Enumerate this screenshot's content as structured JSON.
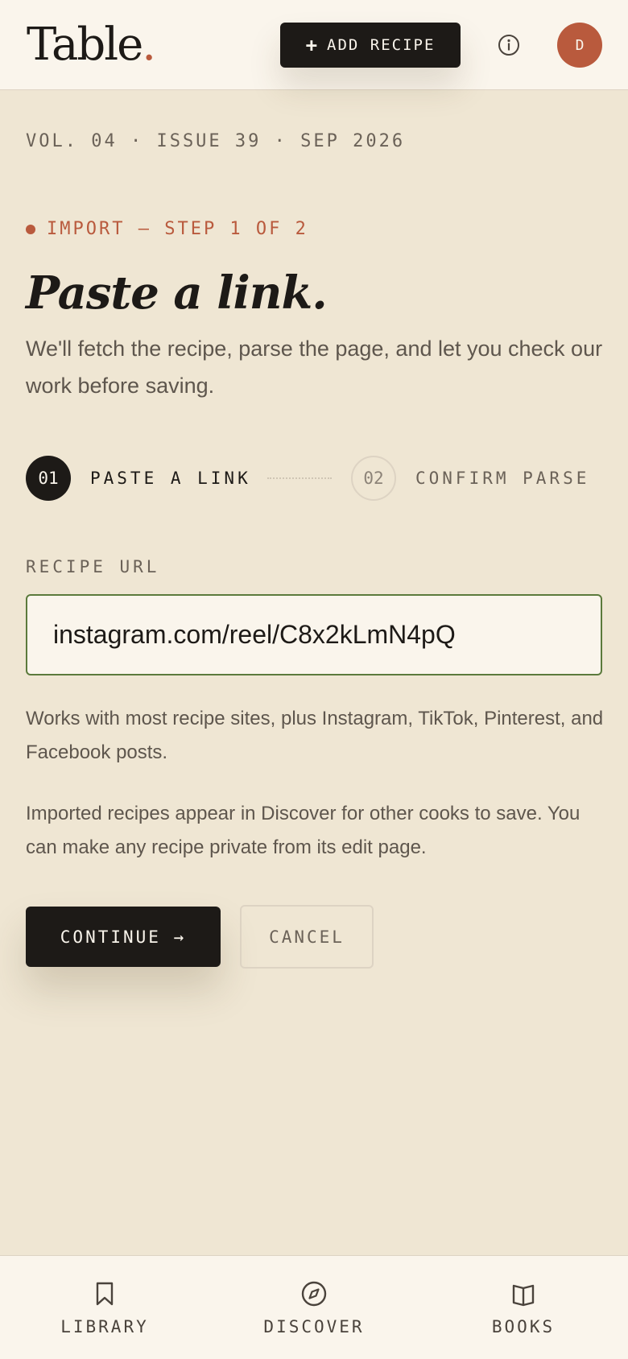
{
  "header": {
    "logo_text": "Table",
    "logo_dot": ".",
    "add_recipe_plus": "+",
    "add_recipe_label": "ADD RECIPE",
    "info_icon": "info-icon",
    "avatar_initial": "D"
  },
  "masthead": {
    "text": "VOL. 04 · ISSUE 39 · SEP 2026"
  },
  "import": {
    "step_label": "IMPORT — STEP 1 OF 2",
    "title": "Paste a link.",
    "subtitle": "We'll fetch the recipe, parse the page, and let you check our work before saving."
  },
  "stepper": {
    "steps": [
      {
        "number": "01",
        "label": "PASTE A LINK",
        "active": true
      },
      {
        "number": "02",
        "label": "CONFIRM PARSE",
        "active": false
      }
    ]
  },
  "form": {
    "url_label": "RECIPE URL",
    "url_value": "instagram.com/reel/C8x2kLmN4pQ",
    "help_text": "Works with most recipe sites, plus Instagram, TikTok, Pinterest, and Facebook posts.",
    "privacy_note": "Imported recipes appear in Discover for other cooks to save. You can make any recipe private from its edit page."
  },
  "actions": {
    "continue_label": "CONTINUE →",
    "cancel_label": "CANCEL"
  },
  "bottom_nav": {
    "items": [
      {
        "label": "LIBRARY",
        "icon": "bookmark-icon"
      },
      {
        "label": "DISCOVER",
        "icon": "compass-icon"
      },
      {
        "label": "BOOKS",
        "icon": "book-open-icon"
      }
    ]
  },
  "colors": {
    "background": "#efe6d3",
    "surface": "#faf5ec",
    "ink": "#1d1a17",
    "accent": "#b95a3d",
    "input_border": "#5b7a3c",
    "muted": "#6b6258"
  }
}
